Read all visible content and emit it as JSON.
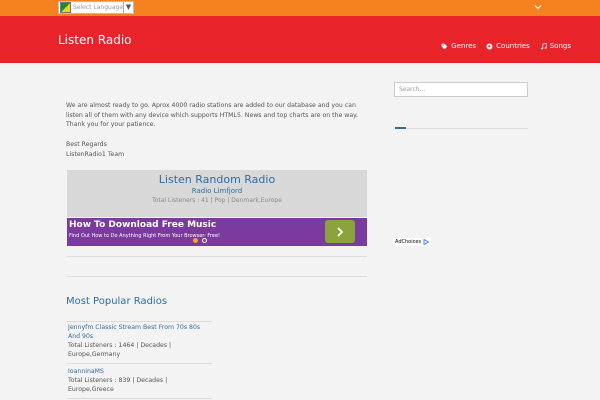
{
  "topbar": {
    "language_select": {
      "value": "Select Language",
      "arrow": "▼"
    },
    "chevron_icon": "chevron-down-icon"
  },
  "header": {
    "brand": "Listen Radio",
    "nav": [
      {
        "label": "Genres",
        "icon": "tags-icon"
      },
      {
        "label": "Countries",
        "icon": "globe-icon"
      },
      {
        "label": "Songs",
        "icon": "music-note-icon"
      }
    ]
  },
  "main": {
    "intro": "We are almost ready to go. Aprox 4000 radio stations are added to our database and you can listen all of them with any device which supports HTML5. News and top charts are on the way. Thank you for your patience.",
    "regards_line1": "Best Regards",
    "regards_line2": "ListenRadio1 Team",
    "player": {
      "title": "Listen Random Radio",
      "station": "Radio Limfjord",
      "info": "Total Listeners : 41 | Pop | Denmark,Europe"
    },
    "ad": {
      "title": "How To Download Free Music",
      "subtitle": "Find Out How to Do Anything Right From Your Browser- Free!",
      "button": "›",
      "choices": "AdChoices"
    },
    "popular": {
      "title": "Most Popular Radios",
      "items": [
        {
          "name": "Jennyfm Classic Stream Best From 70s 80s And 90s",
          "info": "Total Listeners : 1464 | Decades | Europe,Germany"
        },
        {
          "name": "IoanninaMS",
          "info": "Total Listeners : 839 | Decades | Europe,Greece"
        }
      ]
    }
  },
  "sidebar": {
    "search": {
      "placeholder": "Search..."
    }
  },
  "colors": {
    "topbar": "#f5821f",
    "header": "#e8232a",
    "link": "#2e6da4",
    "ad_bg": "#7b3aa0"
  }
}
